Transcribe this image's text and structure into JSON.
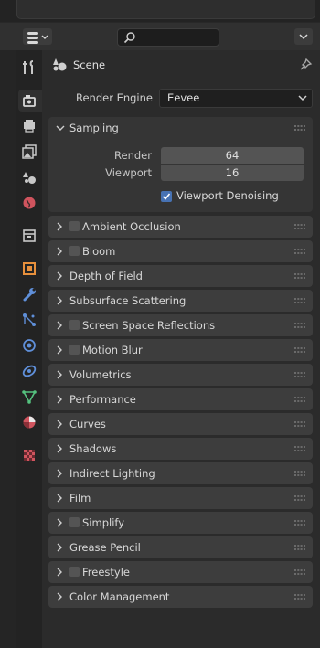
{
  "header": {
    "search_placeholder": "",
    "editor_type_icon": "properties-editor-icon",
    "dropdown_icon": "chevron-down-icon"
  },
  "tabs": [
    {
      "name": "tool-tab",
      "icon": "tool-icon",
      "color": "#c8c8c8"
    },
    {
      "name": "render-tab",
      "icon": "render-camera-icon",
      "color": "#c8c8c8",
      "active": true
    },
    {
      "name": "output-tab",
      "icon": "printer-icon",
      "color": "#c8c8c8"
    },
    {
      "name": "view-layer-tab",
      "icon": "image-stack-icon",
      "color": "#c8c8c8"
    },
    {
      "name": "scene-tab",
      "icon": "scene-icon",
      "color": "#c8c8c8"
    },
    {
      "name": "world-tab",
      "icon": "world-icon",
      "color": "#d0545e"
    },
    {
      "name": "collection-tab",
      "icon": "collection-box-icon",
      "color": "#c8c8c8"
    },
    {
      "name": "object-tab",
      "icon": "object-square-icon",
      "color": "#e8903c"
    },
    {
      "name": "modifier-tab",
      "icon": "wrench-icon",
      "color": "#5f8fd9"
    },
    {
      "name": "particles-tab",
      "icon": "particles-icon",
      "color": "#5f8fd9"
    },
    {
      "name": "physics-tab",
      "icon": "physics-orbit-icon",
      "color": "#5f8fd9"
    },
    {
      "name": "constraints-tab",
      "icon": "constraint-icon",
      "color": "#5f8fd9"
    },
    {
      "name": "data-tab",
      "icon": "mesh-data-icon",
      "color": "#55c27f"
    },
    {
      "name": "material-tab",
      "icon": "material-sphere-icon",
      "color": "#d0545e"
    },
    {
      "name": "texture-tab",
      "icon": "checker-texture-icon",
      "color": "#d0545e"
    }
  ],
  "context": {
    "label": "Scene"
  },
  "render_engine": {
    "label": "Render Engine",
    "value": "Eevee"
  },
  "sampling": {
    "title": "Sampling",
    "render_label": "Render",
    "render_value": "64",
    "viewport_label": "Viewport",
    "viewport_value": "16",
    "denoise_label": "Viewport Denoising",
    "denoise_checked": true
  },
  "panels": [
    {
      "title": "Ambient Occlusion",
      "checkbox": true
    },
    {
      "title": "Bloom",
      "checkbox": true
    },
    {
      "title": "Depth of Field",
      "checkbox": false
    },
    {
      "title": "Subsurface Scattering",
      "checkbox": false
    },
    {
      "title": "Screen Space Reflections",
      "checkbox": true
    },
    {
      "title": "Motion Blur",
      "checkbox": true
    },
    {
      "title": "Volumetrics",
      "checkbox": false
    },
    {
      "title": "Performance",
      "checkbox": false
    },
    {
      "title": "Curves",
      "checkbox": false
    },
    {
      "title": "Shadows",
      "checkbox": false
    },
    {
      "title": "Indirect Lighting",
      "checkbox": false
    },
    {
      "title": "Film",
      "checkbox": false
    },
    {
      "title": "Simplify",
      "checkbox": true
    },
    {
      "title": "Grease Pencil",
      "checkbox": false
    },
    {
      "title": "Freestyle",
      "checkbox": true
    },
    {
      "title": "Color Management",
      "checkbox": false
    }
  ]
}
